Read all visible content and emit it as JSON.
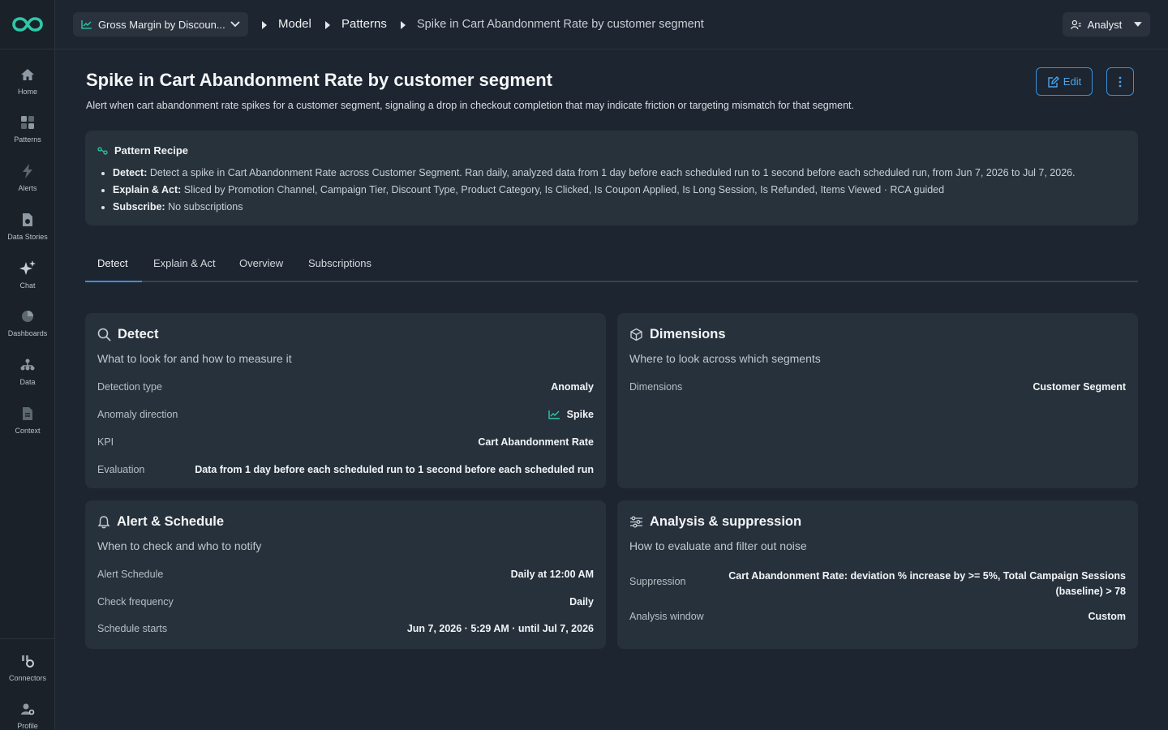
{
  "sidebar": {
    "items": [
      {
        "label": "Home",
        "icon": "home-icon"
      },
      {
        "label": "Patterns",
        "icon": "patterns-icon"
      },
      {
        "label": "Alerts",
        "icon": "lightning-icon"
      },
      {
        "label": "Data Stories",
        "icon": "document-icon"
      },
      {
        "label": "Chat",
        "icon": "sparkle-icon"
      },
      {
        "label": "Dashboards",
        "icon": "pie-chart-icon"
      },
      {
        "label": "Data",
        "icon": "hierarchy-icon"
      },
      {
        "label": "Context",
        "icon": "file-icon"
      }
    ],
    "bottom_items": [
      {
        "label": "Connectors",
        "icon": "connectors-icon"
      },
      {
        "label": "Profile",
        "icon": "user-settings-icon"
      }
    ]
  },
  "topbar": {
    "select_label": "Gross Margin by Discoun...",
    "crumbs": [
      "Model",
      "Patterns",
      "Spike in Cart Abandonment Rate by customer segment"
    ],
    "user_label": "Analyst"
  },
  "header": {
    "title": "Spike in Cart Abandonment Rate by customer segment",
    "description": "Alert when cart abandonment rate spikes for a customer segment, signaling a drop in checkout completion that may indicate friction or targeting mismatch for that segment.",
    "edit_label": "Edit"
  },
  "recipe": {
    "title": "Pattern Recipe",
    "items": [
      {
        "key": "Detect:",
        "text": "Detect a spike in Cart Abandonment Rate across Customer Segment. Ran daily, analyzed data from 1 day before each scheduled run to 1 second before each scheduled run, from Jun 7, 2026 to Jul 7, 2026."
      },
      {
        "key": "Explain & Act:",
        "text": "Sliced by Promotion Channel, Campaign Tier, Discount Type, Product Category, Is Clicked, Is Coupon Applied, Is Long Session, Is Refunded, Items Viewed · RCA guided"
      },
      {
        "key": "Subscribe:",
        "text": "No subscriptions"
      }
    ]
  },
  "tabs": [
    "Detect",
    "Explain & Act",
    "Overview",
    "Subscriptions"
  ],
  "cards": {
    "detect": {
      "title": "Detect",
      "subtitle": "What to look for and how to measure it",
      "rows": [
        {
          "label": "Detection type",
          "value": "Anomaly"
        },
        {
          "label": "Anomaly direction",
          "value": "Spike"
        },
        {
          "label": "KPI",
          "value": "Cart Abandonment Rate"
        },
        {
          "label": "Evaluation",
          "value": "Data from 1 day before each scheduled run to 1 second before each scheduled run"
        }
      ]
    },
    "dimensions": {
      "title": "Dimensions",
      "subtitle": "Where to look across which segments",
      "rows": [
        {
          "label": "Dimensions",
          "value": "Customer Segment"
        }
      ]
    },
    "alert": {
      "title": "Alert & Schedule",
      "subtitle": "When to check and who to notify",
      "rows": [
        {
          "label": "Alert Schedule",
          "value": "Daily at 12:00 AM"
        },
        {
          "label": "Check frequency",
          "value": "Daily"
        },
        {
          "label": "Schedule starts",
          "value": "Jun 7, 2026 · 5:29 AM · until Jul 7, 2026"
        }
      ]
    },
    "analysis": {
      "title": "Analysis & suppression",
      "subtitle": "How to evaluate and filter out noise",
      "rows": [
        {
          "label": "Suppression",
          "value_line1": "Cart Abandonment Rate: deviation % increase by >= 5%, Total Campaign Sessions",
          "value_line2": "(baseline) > 78"
        },
        {
          "label": "Analysis window",
          "value": "Custom"
        }
      ]
    }
  },
  "colors": {
    "accent": "#3b8fd9",
    "teal": "#2fc7a8",
    "background": "#1d2530",
    "card": "#27313b"
  }
}
